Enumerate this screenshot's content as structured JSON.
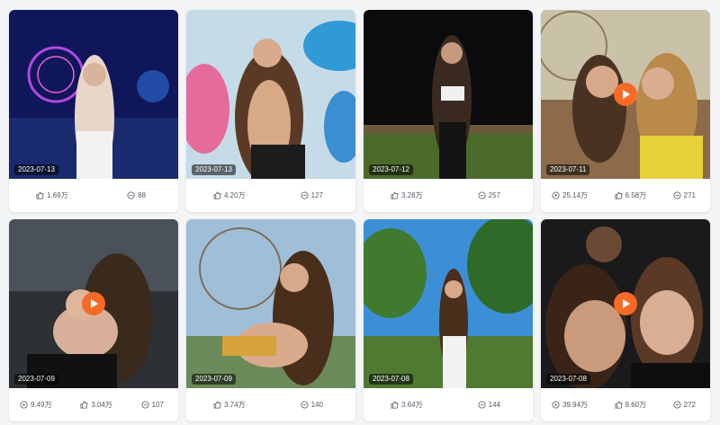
{
  "accent_color": "#f56a27",
  "cards": [
    {
      "date": "2023-07-13",
      "is_video": false,
      "likes": "1.69万",
      "comments": "88",
      "plays": ""
    },
    {
      "date": "2023-07-13",
      "is_video": false,
      "likes": "4.20万",
      "comments": "127",
      "plays": ""
    },
    {
      "date": "2023-07-12",
      "is_video": false,
      "likes": "3.28万",
      "comments": "257",
      "plays": ""
    },
    {
      "date": "2023-07-11",
      "is_video": true,
      "plays": "25.14万",
      "likes": "6.58万",
      "comments": "271"
    },
    {
      "date": "2023-07-09",
      "is_video": true,
      "plays": "9.49万",
      "likes": "3.04万",
      "comments": "107"
    },
    {
      "date": "2023-07-09",
      "is_video": false,
      "likes": "3.74万",
      "comments": "140",
      "plays": ""
    },
    {
      "date": "2023-07-08",
      "is_video": false,
      "likes": "3.64万",
      "comments": "144",
      "plays": ""
    },
    {
      "date": "2023-07-08",
      "is_video": true,
      "plays": "39.94万",
      "likes": "9.60万",
      "comments": "272"
    }
  ],
  "icons": {
    "play": "play-circle-icon",
    "like": "thumbs-up-icon",
    "comment": "comment-icon"
  }
}
